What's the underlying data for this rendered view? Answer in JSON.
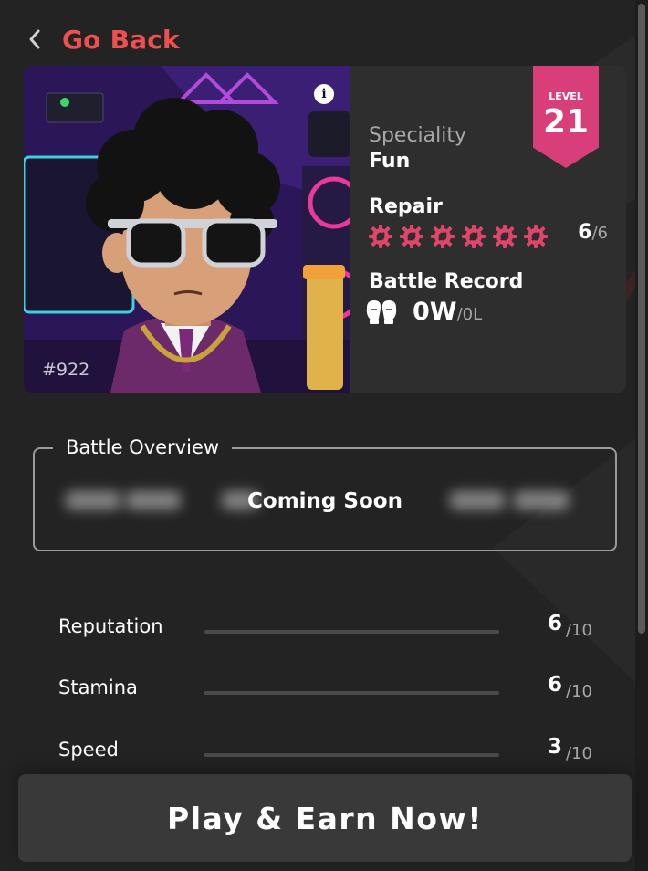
{
  "nav": {
    "back_label": "Go Back"
  },
  "character": {
    "id": "#922",
    "speciality_label": "Speciality",
    "speciality_value": "Fun",
    "level_label": "LEVEL",
    "level_value": "21",
    "repair_label": "Repair",
    "repair_current": "6",
    "repair_max": "/6",
    "repair_icon_count": 6,
    "battle_label": "Battle Record",
    "battle_wins": "0W",
    "battle_losses": "/0L"
  },
  "overview": {
    "title": "Battle Overview",
    "message": "Coming Soon"
  },
  "stats": [
    {
      "name": "Reputation",
      "value": "6",
      "max": "/10",
      "fraction": 0.6
    },
    {
      "name": "Stamina",
      "value": "6",
      "max": "/10",
      "fraction": 0.6
    },
    {
      "name": "Speed",
      "value": "3",
      "max": "/10",
      "fraction": 0.3
    }
  ],
  "cta": {
    "label": "Play & Earn Now!"
  },
  "colors": {
    "background": "#232323",
    "card": "#2e2e2e",
    "accent_red": "#ef4f4f",
    "level_badge": "#d73e7a",
    "repair_icon": "#e0456a",
    "button": "#393939"
  }
}
